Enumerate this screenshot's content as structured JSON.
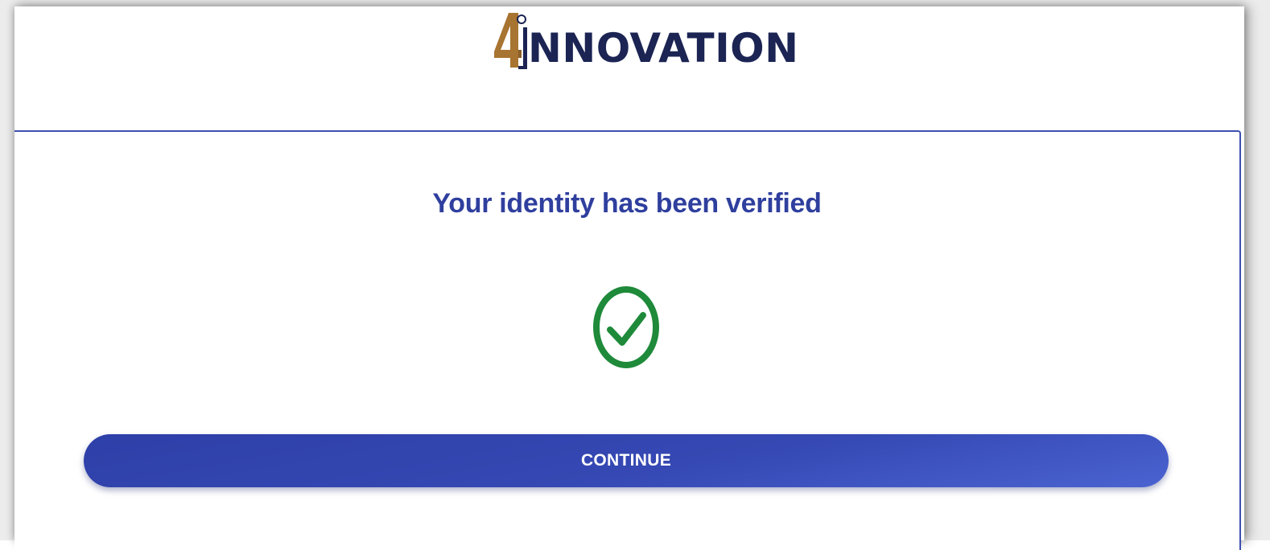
{
  "brand": {
    "logo_text": "NNOVATION",
    "logo_mark": "4i",
    "navy": "#1b2453",
    "gold": "#b07a33"
  },
  "verification": {
    "title": "Your identity has been verified",
    "status_icon": "check-circle-icon",
    "status_color": "#1e8a3a"
  },
  "actions": {
    "continue_label": "CONTINUE"
  },
  "colors": {
    "accent": "#2f3f9e",
    "button": "#3548b3"
  }
}
